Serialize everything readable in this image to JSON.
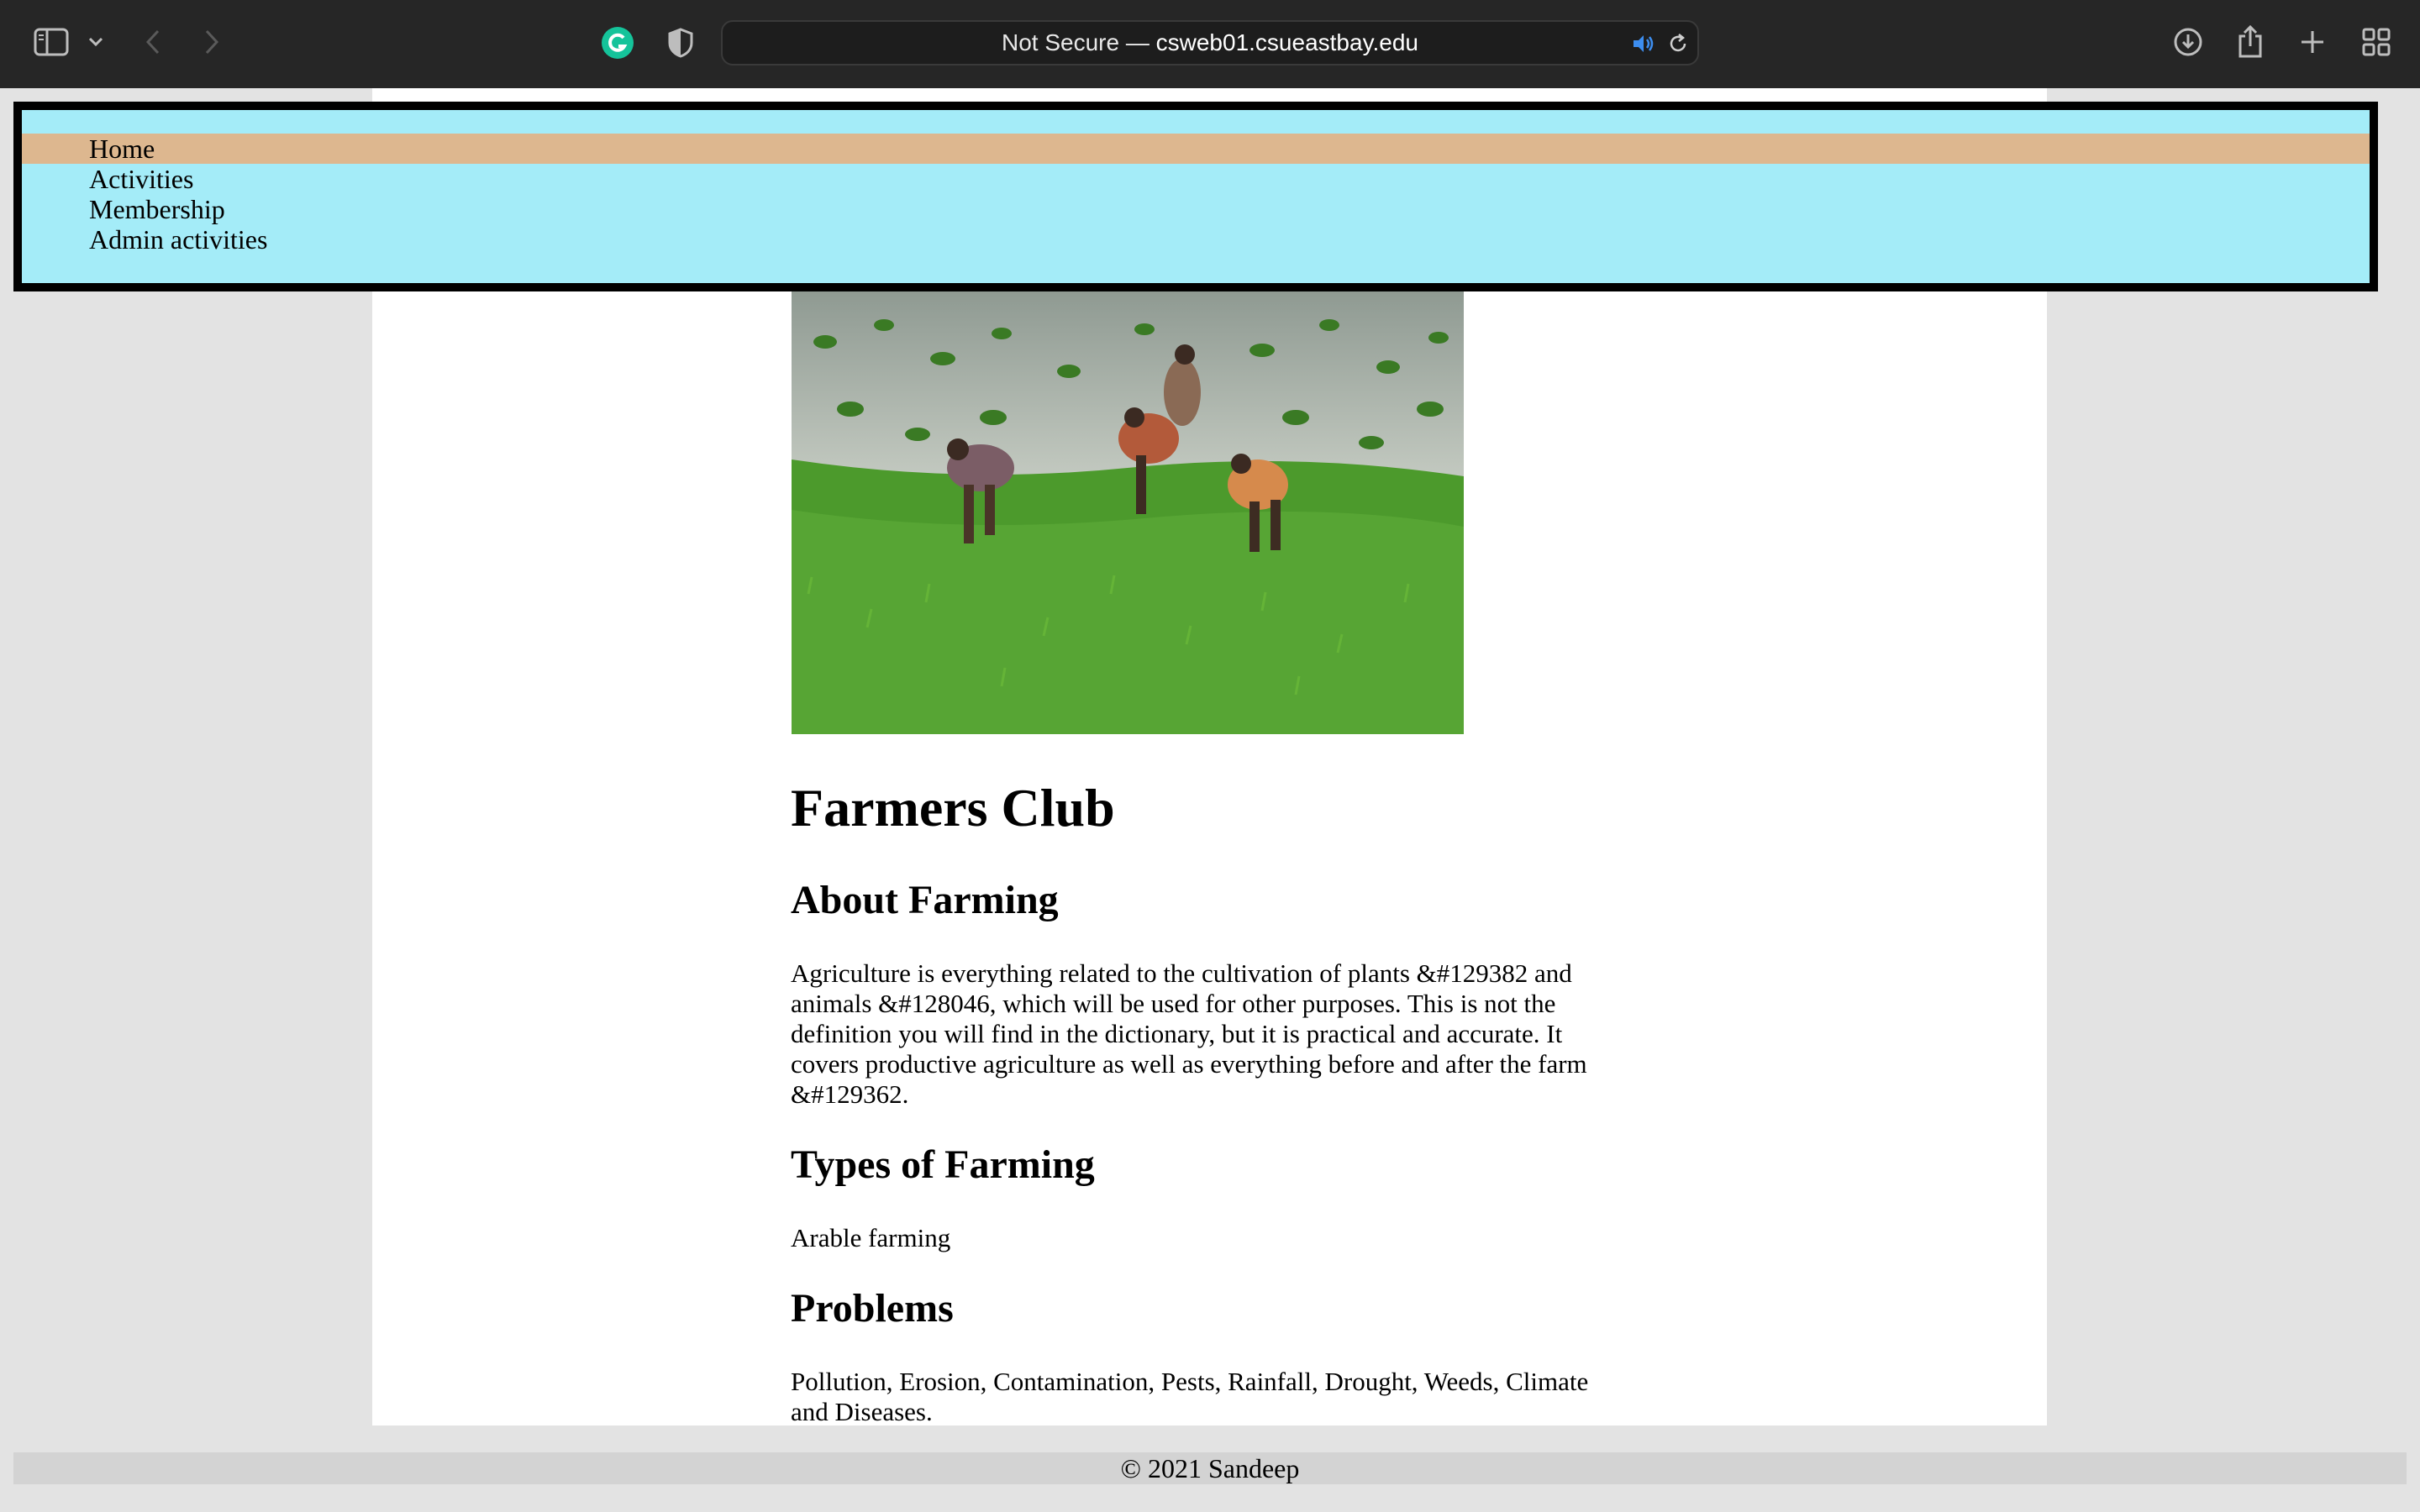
{
  "browser": {
    "address_prefix": "Not Secure — ",
    "address_host": "csweb01.csueastbay.edu"
  },
  "nav": {
    "items": [
      {
        "label": "Home",
        "active": true
      },
      {
        "label": "Activities"
      },
      {
        "label": "Membership"
      },
      {
        "label": "Admin activities"
      }
    ]
  },
  "main": {
    "image_alt": "Farmers planting rice seedlings in a flooded green paddy field",
    "title": "Farmers Club",
    "about_heading": "About Farming",
    "about_text": "Agriculture is everything related to the cultivation of plants &#129382 and animals &#128046, which will be used for other purposes. This is not the definition you will find in the dictionary, but it is practical and accurate. It covers productive agriculture as well as everything before and after the farm &#129362.",
    "types_heading": "Types of Farming",
    "types_text": "Arable farming",
    "problems_heading": "Problems",
    "problems_text": "Pollution, Erosion, Contamination, Pests, Rainfall, Drought, Weeds, Climate and Diseases."
  },
  "footer": {
    "text": "© 2021 Sandeep"
  },
  "colors": {
    "nav_bg": "#a4ecf8",
    "nav_active": "#ddb78f",
    "page_bg": "#e3e3e3",
    "toolbar_bg": "#262626"
  }
}
